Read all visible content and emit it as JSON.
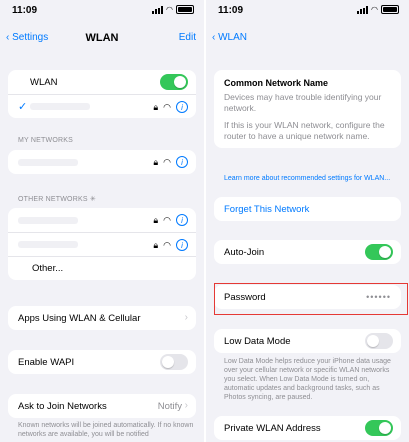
{
  "left": {
    "status": {
      "time": "11:09"
    },
    "nav": {
      "back": "Settings",
      "title": "WLAN",
      "edit": "Edit"
    },
    "wlan_row": {
      "label": "WLAN",
      "on": true
    },
    "my_networks": {
      "header": "MY NETWORKS"
    },
    "other_networks": {
      "header": "OTHER NETWORKS",
      "other_label": "Other..."
    },
    "apps_row": {
      "label": "Apps Using WLAN & Cellular"
    },
    "wapi_row": {
      "label": "Enable WAPI",
      "on": false
    },
    "ask_row": {
      "label": "Ask to Join Networks",
      "value": "Notify"
    },
    "ask_footer": "Known networks will be joined automatically. If no known networks are available, you will be notified"
  },
  "right": {
    "status": {
      "time": "11:09"
    },
    "nav": {
      "back": "WLAN"
    },
    "cnn": {
      "title": "Common Network Name",
      "p1": "Devices may have trouble identifying your network.",
      "p2": "If this is your WLAN network, configure the router to have a unique network name."
    },
    "learn_more": "Learn more about recommended settings for WLAN...",
    "forget": "Forget This Network",
    "auto_join": {
      "label": "Auto-Join",
      "on": true
    },
    "password": {
      "label": "Password",
      "value": "••••••"
    },
    "low_data": {
      "label": "Low Data Mode",
      "on": false,
      "footer": "Low Data Mode helps reduce your iPhone data usage over your cellular network or specific WLAN networks you select. When Low Data Mode is turned on, automatic updates and background tasks, such as Photos syncing, are paused."
    },
    "private_addr": {
      "label": "Private WLAN Address",
      "on": true
    }
  },
  "colors": {
    "accent": "#007aff",
    "toggle_on": "#34c759",
    "highlight": "#e53935"
  },
  "icons": [
    "lock-icon",
    "wifi-icon",
    "info-icon",
    "chevron-right-icon",
    "check-icon",
    "spinner-icon"
  ]
}
